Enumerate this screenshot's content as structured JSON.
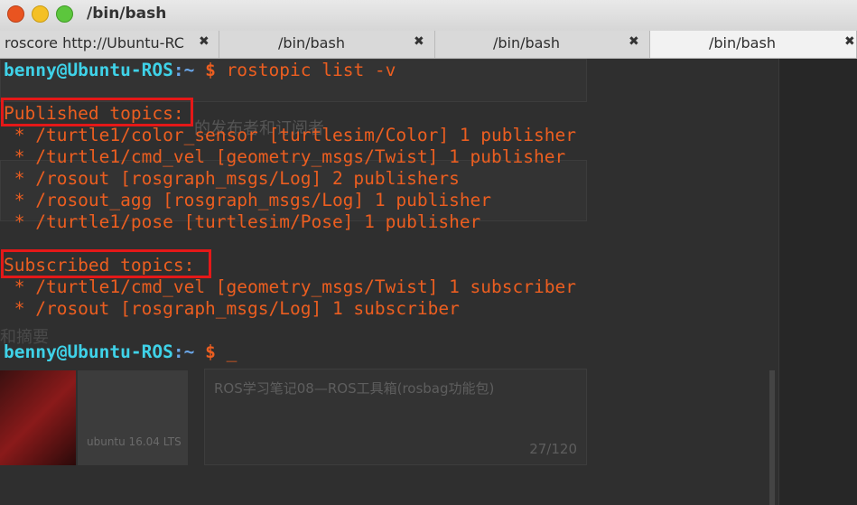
{
  "window": {
    "title": "/bin/bash"
  },
  "tabs": [
    {
      "label": "roscore http://Ubuntu-RC",
      "close": "✖",
      "active": false
    },
    {
      "label": "/bin/bash",
      "close": "✖",
      "active": false
    },
    {
      "label": "/bin/bash",
      "close": "✖",
      "active": false
    },
    {
      "label": "/bin/bash",
      "close": "✖",
      "active": true
    }
  ],
  "terminal": {
    "prompt_user": "benny@Ubuntu-ROS",
    "prompt_sep": ":",
    "prompt_path": "~",
    "prompt_dollar": " $",
    "command": " rostopic list -v",
    "published_header": "Published topics:",
    "published": [
      " * /turtle1/color_sensor [turtlesim/Color] 1 publisher",
      " * /turtle1/cmd_vel [geometry_msgs/Twist] 1 publisher",
      " * /rosout [rosgraph_msgs/Log] 2 publishers",
      " * /rosout_agg [rosgraph_msgs/Log] 1 publisher",
      " * /turtle1/pose [turtlesim/Pose] 1 publisher"
    ],
    "subscribed_header": "Subscribed topics:",
    "subscribed": [
      " * /turtle1/cmd_vel [geometry_msgs/Twist] 1 subscriber",
      " * /rosout [rosgraph_msgs/Log] 1 subscriber"
    ],
    "cursor": " _"
  },
  "background_page": {
    "heading_fragment": "的发布者和订阅者",
    "summary_label": "和摘要",
    "thumb_caption": "ubuntu 16.04 LTS",
    "article_title": "ROS学习笔记08—ROS工具箱(rosbag功能包)",
    "article_count": "27/120"
  },
  "colors": {
    "prompt_user": "#3fd2e8",
    "prompt_path": "#6aa6e8",
    "output": "#ec5e20",
    "highlight_box": "#e51818",
    "terminal_bg": "#2f2f2f"
  }
}
